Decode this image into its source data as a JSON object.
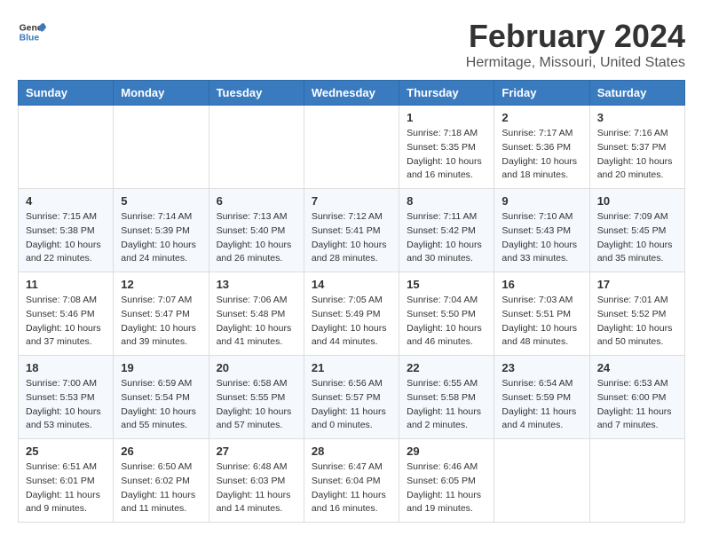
{
  "header": {
    "logo_line1": "General",
    "logo_line2": "Blue",
    "month": "February 2024",
    "location": "Hermitage, Missouri, United States"
  },
  "weekdays": [
    "Sunday",
    "Monday",
    "Tuesday",
    "Wednesday",
    "Thursday",
    "Friday",
    "Saturday"
  ],
  "weeks": [
    [
      {
        "day": "",
        "info": ""
      },
      {
        "day": "",
        "info": ""
      },
      {
        "day": "",
        "info": ""
      },
      {
        "day": "",
        "info": ""
      },
      {
        "day": "1",
        "info": "Sunrise: 7:18 AM\nSunset: 5:35 PM\nDaylight: 10 hours\nand 16 minutes."
      },
      {
        "day": "2",
        "info": "Sunrise: 7:17 AM\nSunset: 5:36 PM\nDaylight: 10 hours\nand 18 minutes."
      },
      {
        "day": "3",
        "info": "Sunrise: 7:16 AM\nSunset: 5:37 PM\nDaylight: 10 hours\nand 20 minutes."
      }
    ],
    [
      {
        "day": "4",
        "info": "Sunrise: 7:15 AM\nSunset: 5:38 PM\nDaylight: 10 hours\nand 22 minutes."
      },
      {
        "day": "5",
        "info": "Sunrise: 7:14 AM\nSunset: 5:39 PM\nDaylight: 10 hours\nand 24 minutes."
      },
      {
        "day": "6",
        "info": "Sunrise: 7:13 AM\nSunset: 5:40 PM\nDaylight: 10 hours\nand 26 minutes."
      },
      {
        "day": "7",
        "info": "Sunrise: 7:12 AM\nSunset: 5:41 PM\nDaylight: 10 hours\nand 28 minutes."
      },
      {
        "day": "8",
        "info": "Sunrise: 7:11 AM\nSunset: 5:42 PM\nDaylight: 10 hours\nand 30 minutes."
      },
      {
        "day": "9",
        "info": "Sunrise: 7:10 AM\nSunset: 5:43 PM\nDaylight: 10 hours\nand 33 minutes."
      },
      {
        "day": "10",
        "info": "Sunrise: 7:09 AM\nSunset: 5:45 PM\nDaylight: 10 hours\nand 35 minutes."
      }
    ],
    [
      {
        "day": "11",
        "info": "Sunrise: 7:08 AM\nSunset: 5:46 PM\nDaylight: 10 hours\nand 37 minutes."
      },
      {
        "day": "12",
        "info": "Sunrise: 7:07 AM\nSunset: 5:47 PM\nDaylight: 10 hours\nand 39 minutes."
      },
      {
        "day": "13",
        "info": "Sunrise: 7:06 AM\nSunset: 5:48 PM\nDaylight: 10 hours\nand 41 minutes."
      },
      {
        "day": "14",
        "info": "Sunrise: 7:05 AM\nSunset: 5:49 PM\nDaylight: 10 hours\nand 44 minutes."
      },
      {
        "day": "15",
        "info": "Sunrise: 7:04 AM\nSunset: 5:50 PM\nDaylight: 10 hours\nand 46 minutes."
      },
      {
        "day": "16",
        "info": "Sunrise: 7:03 AM\nSunset: 5:51 PM\nDaylight: 10 hours\nand 48 minutes."
      },
      {
        "day": "17",
        "info": "Sunrise: 7:01 AM\nSunset: 5:52 PM\nDaylight: 10 hours\nand 50 minutes."
      }
    ],
    [
      {
        "day": "18",
        "info": "Sunrise: 7:00 AM\nSunset: 5:53 PM\nDaylight: 10 hours\nand 53 minutes."
      },
      {
        "day": "19",
        "info": "Sunrise: 6:59 AM\nSunset: 5:54 PM\nDaylight: 10 hours\nand 55 minutes."
      },
      {
        "day": "20",
        "info": "Sunrise: 6:58 AM\nSunset: 5:55 PM\nDaylight: 10 hours\nand 57 minutes."
      },
      {
        "day": "21",
        "info": "Sunrise: 6:56 AM\nSunset: 5:57 PM\nDaylight: 11 hours\nand 0 minutes."
      },
      {
        "day": "22",
        "info": "Sunrise: 6:55 AM\nSunset: 5:58 PM\nDaylight: 11 hours\nand 2 minutes."
      },
      {
        "day": "23",
        "info": "Sunrise: 6:54 AM\nSunset: 5:59 PM\nDaylight: 11 hours\nand 4 minutes."
      },
      {
        "day": "24",
        "info": "Sunrise: 6:53 AM\nSunset: 6:00 PM\nDaylight: 11 hours\nand 7 minutes."
      }
    ],
    [
      {
        "day": "25",
        "info": "Sunrise: 6:51 AM\nSunset: 6:01 PM\nDaylight: 11 hours\nand 9 minutes."
      },
      {
        "day": "26",
        "info": "Sunrise: 6:50 AM\nSunset: 6:02 PM\nDaylight: 11 hours\nand 11 minutes."
      },
      {
        "day": "27",
        "info": "Sunrise: 6:48 AM\nSunset: 6:03 PM\nDaylight: 11 hours\nand 14 minutes."
      },
      {
        "day": "28",
        "info": "Sunrise: 6:47 AM\nSunset: 6:04 PM\nDaylight: 11 hours\nand 16 minutes."
      },
      {
        "day": "29",
        "info": "Sunrise: 6:46 AM\nSunset: 6:05 PM\nDaylight: 11 hours\nand 19 minutes."
      },
      {
        "day": "",
        "info": ""
      },
      {
        "day": "",
        "info": ""
      }
    ]
  ]
}
